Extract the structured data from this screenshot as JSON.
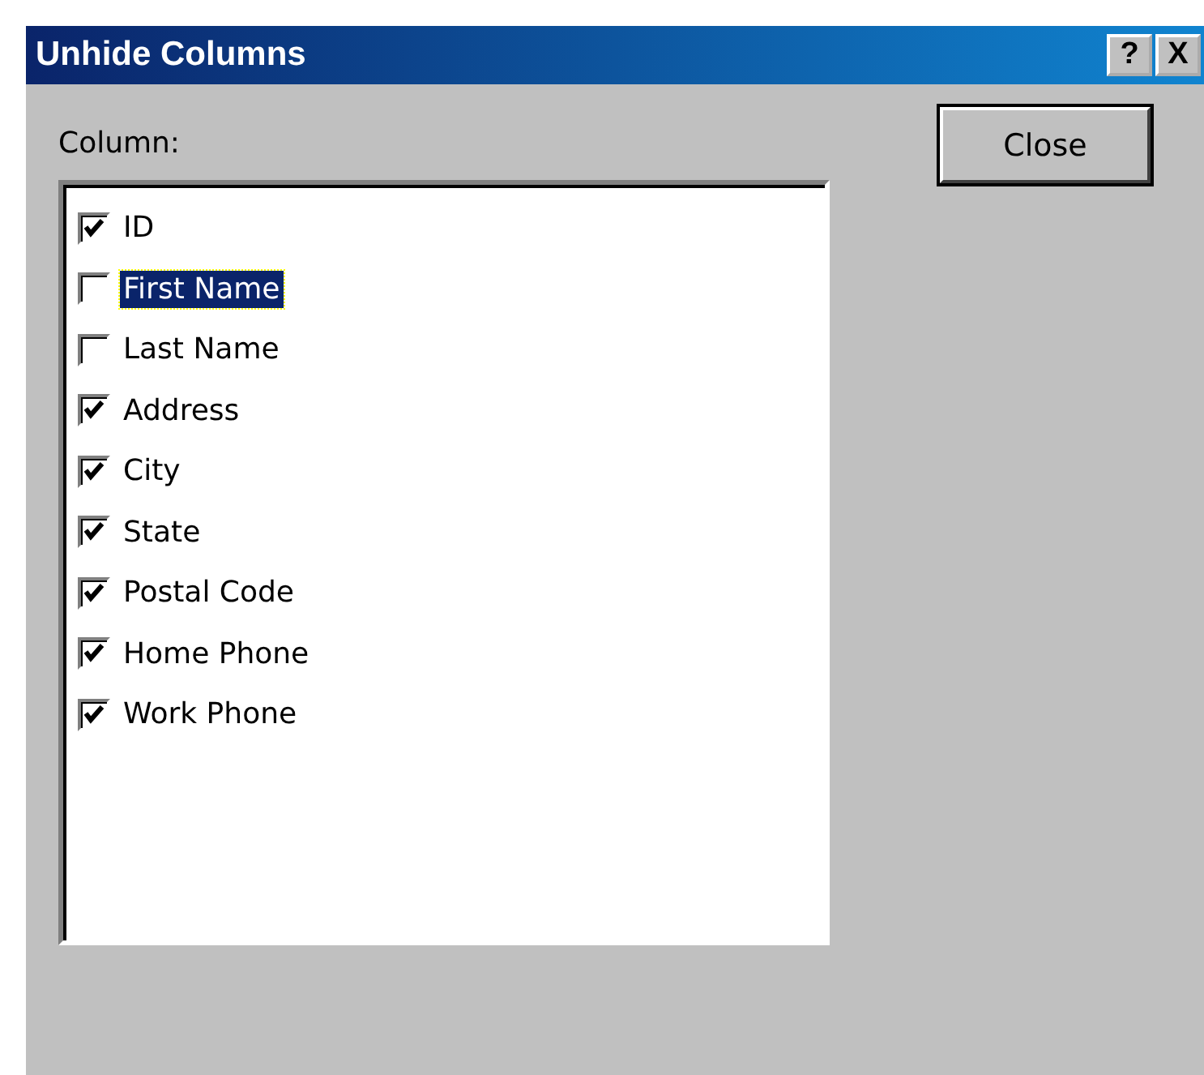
{
  "window": {
    "title": "Unhide Columns",
    "title_buttons": [
      "?",
      "X"
    ]
  },
  "column_label": "Column:",
  "columns": [
    {
      "label": "ID",
      "checked": true,
      "selected": false
    },
    {
      "label": "First Name",
      "checked": false,
      "selected": true
    },
    {
      "label": "Last Name",
      "checked": false,
      "selected": false
    },
    {
      "label": "Address",
      "checked": true,
      "selected": false
    },
    {
      "label": "City",
      "checked": true,
      "selected": false
    },
    {
      "label": "State",
      "checked": true,
      "selected": false
    },
    {
      "label": "Postal Code",
      "checked": true,
      "selected": false
    },
    {
      "label": "Home Phone",
      "checked": true,
      "selected": false
    },
    {
      "label": "Work Phone",
      "checked": true,
      "selected": false
    }
  ],
  "buttons": [
    "Close"
  ]
}
